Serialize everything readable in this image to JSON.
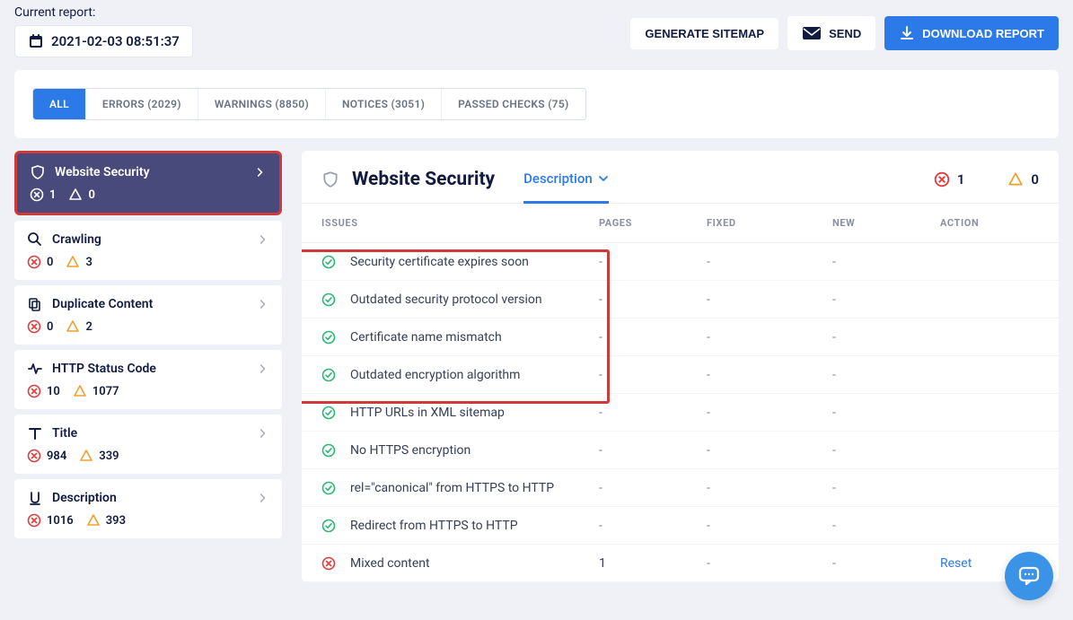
{
  "top": {
    "report_label": "Current report:",
    "report_value": "2021-02-03 08:51:37",
    "generate_label": "GENERATE SITEMAP",
    "send_label": "SEND",
    "download_label": "DOWNLOAD REPORT"
  },
  "tabs": [
    {
      "label": "ALL",
      "active": true
    },
    {
      "label": "ERRORS (2029)",
      "active": false
    },
    {
      "label": "WARNINGS (8850)",
      "active": false
    },
    {
      "label": "NOTICES (3051)",
      "active": false
    },
    {
      "label": "PASSED CHECKS (75)",
      "active": false
    }
  ],
  "sidebar": [
    {
      "title": "Website Security",
      "errors": "1",
      "warnings": "0",
      "icon": "shield",
      "active": true
    },
    {
      "title": "Crawling",
      "errors": "0",
      "warnings": "3",
      "icon": "search",
      "active": false
    },
    {
      "title": "Duplicate Content",
      "errors": "0",
      "warnings": "2",
      "icon": "copy",
      "active": false
    },
    {
      "title": "HTTP Status Code",
      "errors": "10",
      "warnings": "1077",
      "icon": "pulse",
      "active": false
    },
    {
      "title": "Title",
      "errors": "984",
      "warnings": "339",
      "icon": "t",
      "active": false
    },
    {
      "title": "Description",
      "errors": "1016",
      "warnings": "393",
      "icon": "u",
      "active": false
    }
  ],
  "main": {
    "title": "Website Security",
    "dropdown": "Description",
    "header_errors": "1",
    "header_warnings": "0",
    "columns": {
      "c1": "ISSUES",
      "c2": "PAGES",
      "c3": "FIXED",
      "c4": "NEW",
      "c5": "ACTION"
    },
    "rows": [
      {
        "status": "ok",
        "issue": "Security certificate expires soon",
        "pages": "-",
        "fixed": "-",
        "new": "-",
        "action": ""
      },
      {
        "status": "ok",
        "issue": "Outdated security protocol version",
        "pages": "-",
        "fixed": "-",
        "new": "-",
        "action": ""
      },
      {
        "status": "ok",
        "issue": "Certificate name mismatch",
        "pages": "-",
        "fixed": "-",
        "new": "-",
        "action": ""
      },
      {
        "status": "ok",
        "issue": "Outdated encryption algorithm",
        "pages": "-",
        "fixed": "-",
        "new": "-",
        "action": ""
      },
      {
        "status": "ok",
        "issue": "HTTP URLs in XML sitemap",
        "pages": "-",
        "fixed": "-",
        "new": "-",
        "action": ""
      },
      {
        "status": "ok",
        "issue": "No HTTPS encryption",
        "pages": "-",
        "fixed": "-",
        "new": "-",
        "action": ""
      },
      {
        "status": "ok",
        "issue": "rel=\"canonical\" from HTTPS to HTTP",
        "pages": "-",
        "fixed": "-",
        "new": "-",
        "action": ""
      },
      {
        "status": "ok",
        "issue": "Redirect from HTTPS to HTTP",
        "pages": "-",
        "fixed": "-",
        "new": "-",
        "action": ""
      },
      {
        "status": "err",
        "issue": "Mixed content",
        "pages": "1",
        "fixed": "-",
        "new": "-",
        "action": "Reset"
      }
    ]
  },
  "colors": {
    "accent": "#2c7ae8",
    "error": "#e63a3a",
    "warning": "#f0a030",
    "pass": "#2bb673",
    "sidebar_active": "#474a7a",
    "highlight": "#cf3a39"
  }
}
